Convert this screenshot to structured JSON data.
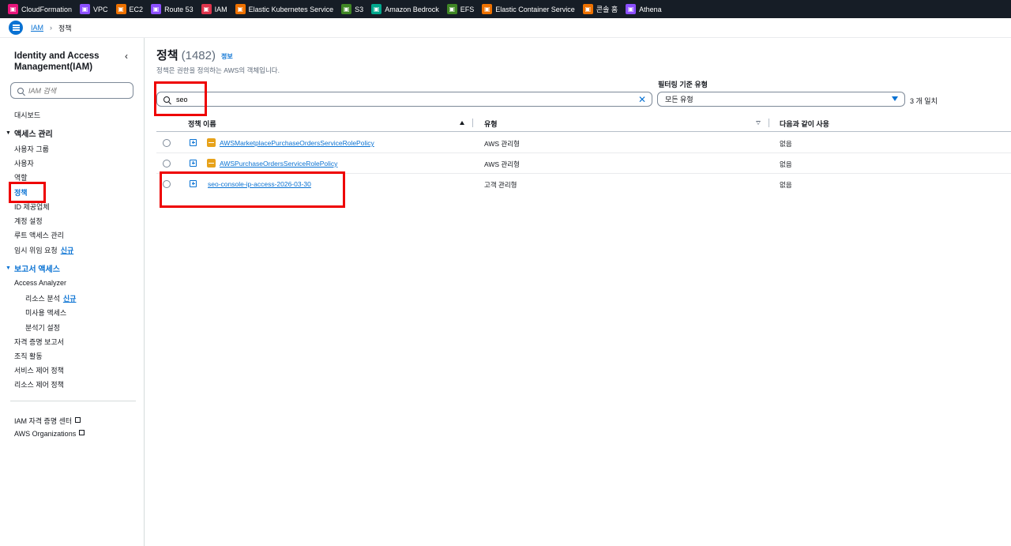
{
  "services": [
    {
      "label": "CloudFormation",
      "icon": "cloudformation-icon",
      "color": "#e7157b"
    },
    {
      "label": "VPC",
      "icon": "vpc-icon",
      "color": "#8c4fff"
    },
    {
      "label": "EC2",
      "icon": "ec2-icon",
      "color": "#ed7100"
    },
    {
      "label": "Route 53",
      "icon": "route53-icon",
      "color": "#8c4fff"
    },
    {
      "label": "IAM",
      "icon": "iam-icon",
      "color": "#dd344c"
    },
    {
      "label": "Elastic Kubernetes Service",
      "icon": "eks-icon",
      "color": "#ed7100"
    },
    {
      "label": "S3",
      "icon": "s3-icon",
      "color": "#3f8624"
    },
    {
      "label": "Amazon Bedrock",
      "icon": "bedrock-icon",
      "color": "#01a88d"
    },
    {
      "label": "EFS",
      "icon": "efs-icon",
      "color": "#3f8624"
    },
    {
      "label": "Elastic Container Service",
      "icon": "ecs-icon",
      "color": "#ed7100"
    },
    {
      "label": "콘솔 홈",
      "icon": "console-home-icon",
      "color": "#ed7100"
    },
    {
      "label": "Athena",
      "icon": "athena-icon",
      "color": "#8c4fff"
    }
  ],
  "breadcrumb": {
    "root": "IAM",
    "current": "정책"
  },
  "sidebar": {
    "title": "Identity and Access Management(IAM)",
    "search_placeholder": "IAM 검색",
    "dashboard": "대시보드",
    "access_mgmt": "액세스 관리",
    "user_groups": "사용자 그룹",
    "users": "사용자",
    "roles": "역할",
    "policies": "정책",
    "id_providers": "ID 제공업체",
    "account_settings": "계정 설정",
    "root_access": "루트 액세스 관리",
    "temp_delegation": "임시 위임 요청",
    "new_badge": "신규",
    "reports_access": "보고서 액세스",
    "access_analyzer": "Access Analyzer",
    "resource_analysis": "리소스 분석",
    "unused_access": "미사용 액세스",
    "analyzer_settings": "분석기 설정",
    "credential_report": "자격 증명 보고서",
    "org_activity": "조직 활동",
    "scp": "서비스 제어 정책",
    "rcp": "리소스 제어 정책",
    "iam_identity_center": "IAM 자격 증명 센터",
    "aws_organizations": "AWS Organizations"
  },
  "main": {
    "title": "정책",
    "count": "(1482)",
    "info": "정보",
    "description": "정책은 권한을 정의하는 AWS의 객체입니다.",
    "search_value": "seo",
    "filter_label": "필터링 기준 유형",
    "filter_value": "모든 유형",
    "match_count": "3 개 일치",
    "columns": {
      "name": "정책 이름",
      "type": "유형",
      "used_as": "다음과 같이 사용"
    },
    "rows": [
      {
        "name": "AWSMarketplacePurchaseOrdersServiceRolePolicy",
        "type": "AWS 관리형",
        "used_as": "없음",
        "aws_managed": true
      },
      {
        "name": "AWSPurchaseOrdersServiceRolePolicy",
        "type": "AWS 관리형",
        "used_as": "없음",
        "aws_managed": true
      },
      {
        "name": "seo-console-ip-access-2026-03-30",
        "type": "고객 관리형",
        "used_as": "없음",
        "aws_managed": false
      }
    ]
  }
}
